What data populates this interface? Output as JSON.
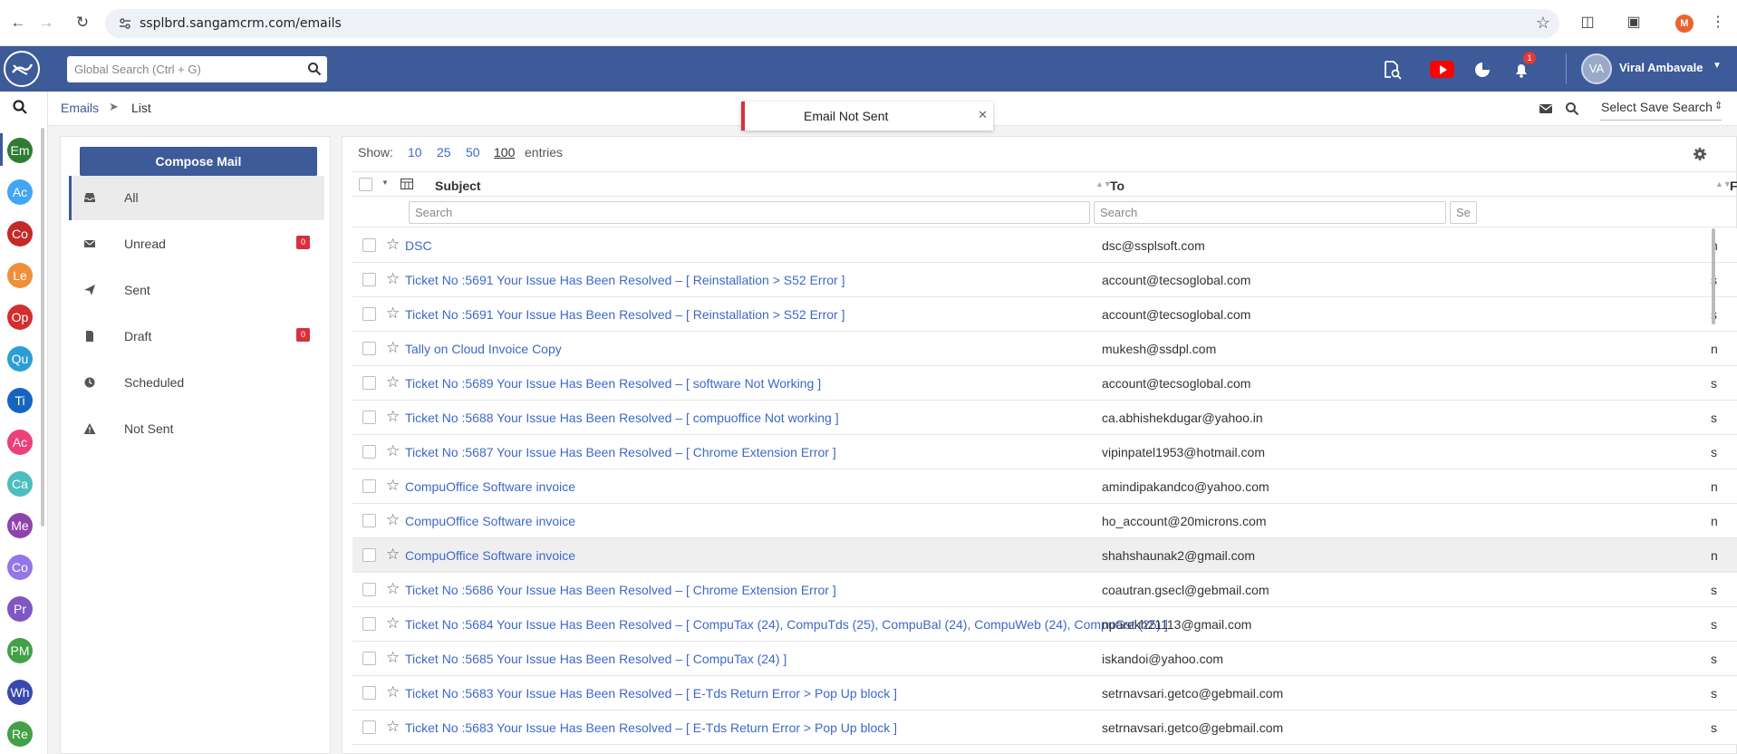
{
  "browser": {
    "url": "ssplbrd.sangamcrm.com/emails",
    "profile_initial": "M"
  },
  "header": {
    "search_placeholder": "Global Search (Ctrl + G)",
    "notification_count": "1",
    "user_initials": "VA",
    "user_name": "Viral Ambavale"
  },
  "modules": [
    {
      "label": "Em",
      "color": "#2e7d32"
    },
    {
      "label": "Ac",
      "color": "#42a5f5"
    },
    {
      "label": "Co",
      "color": "#c62828"
    },
    {
      "label": "Le",
      "color": "#ef8f3a"
    },
    {
      "label": "Op",
      "color": "#d32f2f"
    },
    {
      "label": "Qu",
      "color": "#2b9fd4"
    },
    {
      "label": "Ti",
      "color": "#1565c0"
    },
    {
      "label": "Ac",
      "color": "#ec407a"
    },
    {
      "label": "Ca",
      "color": "#4dbdbd"
    },
    {
      "label": "Me",
      "color": "#8e44ad"
    },
    {
      "label": "Co",
      "color": "#9575e8"
    },
    {
      "label": "Pr",
      "color": "#7e57c2"
    },
    {
      "label": "PM",
      "color": "#43a047"
    },
    {
      "label": "Wh",
      "color": "#3949ab"
    },
    {
      "label": "Re",
      "color": "#43a047"
    }
  ],
  "breadcrumb": {
    "module": "Emails",
    "page": "List"
  },
  "toast": {
    "message": "Email Not Sent"
  },
  "save_search": {
    "label": "Select Save Search"
  },
  "folders": {
    "compose_label": "Compose Mail",
    "items": [
      {
        "label": "All",
        "icon": "inbox-icon"
      },
      {
        "label": "Unread",
        "icon": "envelope-icon",
        "badge": "0"
      },
      {
        "label": "Sent",
        "icon": "paper-plane-icon"
      },
      {
        "label": "Draft",
        "icon": "file-icon",
        "badge": "0"
      },
      {
        "label": "Scheduled",
        "icon": "clock-icon"
      },
      {
        "label": "Not Sent",
        "icon": "warning-icon"
      }
    ]
  },
  "list": {
    "show_label": "Show:",
    "page_sizes": [
      "10",
      "25",
      "50",
      "100"
    ],
    "selected_page_size": "100",
    "entries_label": "entries",
    "columns": {
      "subject": "Subject",
      "to": "To",
      "from": "F"
    },
    "search_placeholder": "Search",
    "search_placeholder_short": "Se",
    "rows": [
      {
        "subject": "DSC",
        "to": "dsc@ssplsoft.com",
        "from": "n"
      },
      {
        "subject": "Ticket No :5691 Your Issue Has Been Resolved – [ Reinstallation > S52 Error ]",
        "to": "account@tecsoglobal.com",
        "from": "s"
      },
      {
        "subject": "Ticket No :5691 Your Issue Has Been Resolved – [ Reinstallation > S52 Error ]",
        "to": "account@tecsoglobal.com",
        "from": "s"
      },
      {
        "subject": "Tally on Cloud Invoice Copy",
        "to": "mukesh@ssdpl.com",
        "from": "n"
      },
      {
        "subject": "Ticket No :5689 Your Issue Has Been Resolved – [ software Not Working ]",
        "to": "account@tecsoglobal.com",
        "from": "s"
      },
      {
        "subject": "Ticket No :5688 Your Issue Has Been Resolved – [ compuoffice Not working ]",
        "to": "ca.abhishekdugar@yahoo.in",
        "from": "s"
      },
      {
        "subject": "Ticket No :5687 Your Issue Has Been Resolved – [ Chrome Extension Error ]",
        "to": "vipinpatel1953@hotmail.com",
        "from": "s"
      },
      {
        "subject": "CompuOffice Software invoice",
        "to": "amindipakandco@yahoo.com",
        "from": "n"
      },
      {
        "subject": "CompuOffice Software invoice",
        "to": "ho_account@20microns.com",
        "from": "n"
      },
      {
        "subject": "CompuOffice Software invoice",
        "to": "shahshaunak2@gmail.com",
        "from": "n"
      },
      {
        "subject": "Ticket No :5686 Your Issue Has Been Resolved – [ Chrome Extension Error ]",
        "to": "coautran.gsecl@gebmail.com",
        "from": "s"
      },
      {
        "subject": "Ticket No :5684 Your Issue Has Been Resolved – [ CompuTax (24), CompuTds (25), CompuBal (24), CompuWeb (24), CompuGst (25) ]",
        "to": "nparekh21113@gmail.com",
        "from": "s"
      },
      {
        "subject": "Ticket No :5685 Your Issue Has Been Resolved – [ CompuTax (24) ]",
        "to": "iskandoi@yahoo.com",
        "from": "s"
      },
      {
        "subject": "Ticket No :5683 Your Issue Has Been Resolved – [ E-Tds Return Error > Pop Up block ]",
        "to": "setrnavsari.getco@gebmail.com",
        "from": "s"
      },
      {
        "subject": "Ticket No :5683 Your Issue Has Been Resolved – [ E-Tds Return Error > Pop Up block ]",
        "to": "setrnavsari.getco@gebmail.com",
        "from": "s"
      }
    ],
    "highlighted_row": 9
  }
}
